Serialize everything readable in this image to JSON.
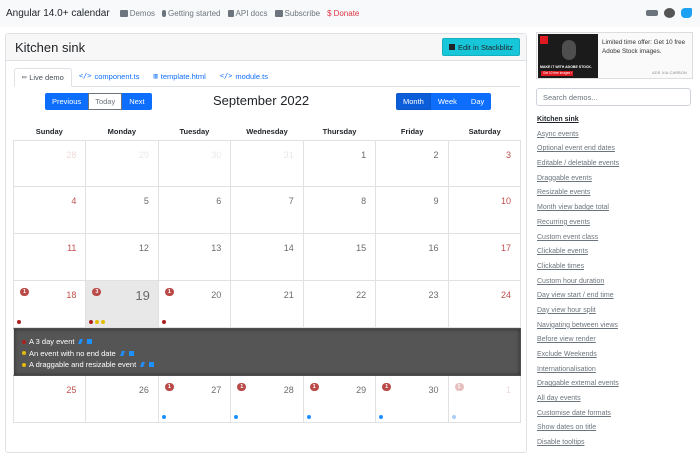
{
  "navbar": {
    "brand": "Angular 14.0+ calendar",
    "links": [
      {
        "label": "Demos",
        "icon": "monitor-icon"
      },
      {
        "label": "Getting started",
        "icon": "lightbulb-icon"
      },
      {
        "label": "API docs",
        "icon": "book-icon"
      },
      {
        "label": "Subscribe",
        "icon": "envelope-icon"
      },
      {
        "label": "Donate",
        "icon": "dollar-icon"
      }
    ]
  },
  "card": {
    "title": "Kitchen sink",
    "edit_label": "Edit in Stackblitz",
    "tabs": [
      "Live demo",
      "component.ts",
      "template.html",
      "module.ts"
    ]
  },
  "calendar": {
    "nav": [
      "Previous",
      "Today",
      "Next"
    ],
    "title": "September 2022",
    "views": [
      "Month",
      "Week",
      "Day"
    ],
    "weekdays": [
      "Sunday",
      "Monday",
      "Tuesday",
      "Wednesday",
      "Thursday",
      "Friday",
      "Saturday"
    ],
    "weeks": [
      [
        "28",
        "29",
        "30",
        "31",
        "1",
        "2",
        "3"
      ],
      [
        "4",
        "5",
        "6",
        "7",
        "8",
        "9",
        "10"
      ],
      [
        "11",
        "12",
        "13",
        "14",
        "15",
        "16",
        "17"
      ],
      [
        "18",
        "19",
        "20",
        "21",
        "22",
        "23",
        "24"
      ],
      [
        "25",
        "26",
        "27",
        "28",
        "29",
        "30",
        "1"
      ]
    ],
    "badges": {
      "r3c0": "1",
      "r3c1": "3",
      "r3c2": "1",
      "r4c2": "1",
      "r4c3": "1",
      "r4c4": "1",
      "r4c5": "1",
      "r4c6": "1"
    },
    "open_events": [
      {
        "title": "A 3 day event",
        "color": "#ad2121"
      },
      {
        "title": "An event with no end date",
        "color": "#e3bc08"
      },
      {
        "title": "A draggable and resizable event",
        "color": "#e3bc08"
      }
    ],
    "colors": {
      "red": "#ad2121",
      "blue": "#1e90ff",
      "yellow": "#e3bc08",
      "pale": "#a8d0f5"
    }
  },
  "ad": {
    "caption": "MAKE IT WITH ADOBE STOCK.",
    "cta": "Get 10 free images ›",
    "text": "Limited time offer: Get 10 free Adobe Stock images.",
    "via": "ADS VIA CARBON"
  },
  "sidebar": {
    "search_placeholder": "Search demos...",
    "demos": [
      "Kitchen sink",
      "Async events",
      "Optional event end dates",
      "Editable / deletable events",
      "Draggable events",
      "Resizable events",
      "Month view badge total",
      "Recurring events",
      "Custom event class",
      "Clickable events",
      "Clickable times",
      "Custom hour duration",
      "Day view start / end time",
      "Day view hour split",
      "Navigating between views",
      "Before view render",
      "Exclude Weekends",
      "Internationalisation",
      "Draggable external events",
      "All day events",
      "Customise date formats",
      "Show dates on title",
      "Disable tooltips"
    ]
  }
}
